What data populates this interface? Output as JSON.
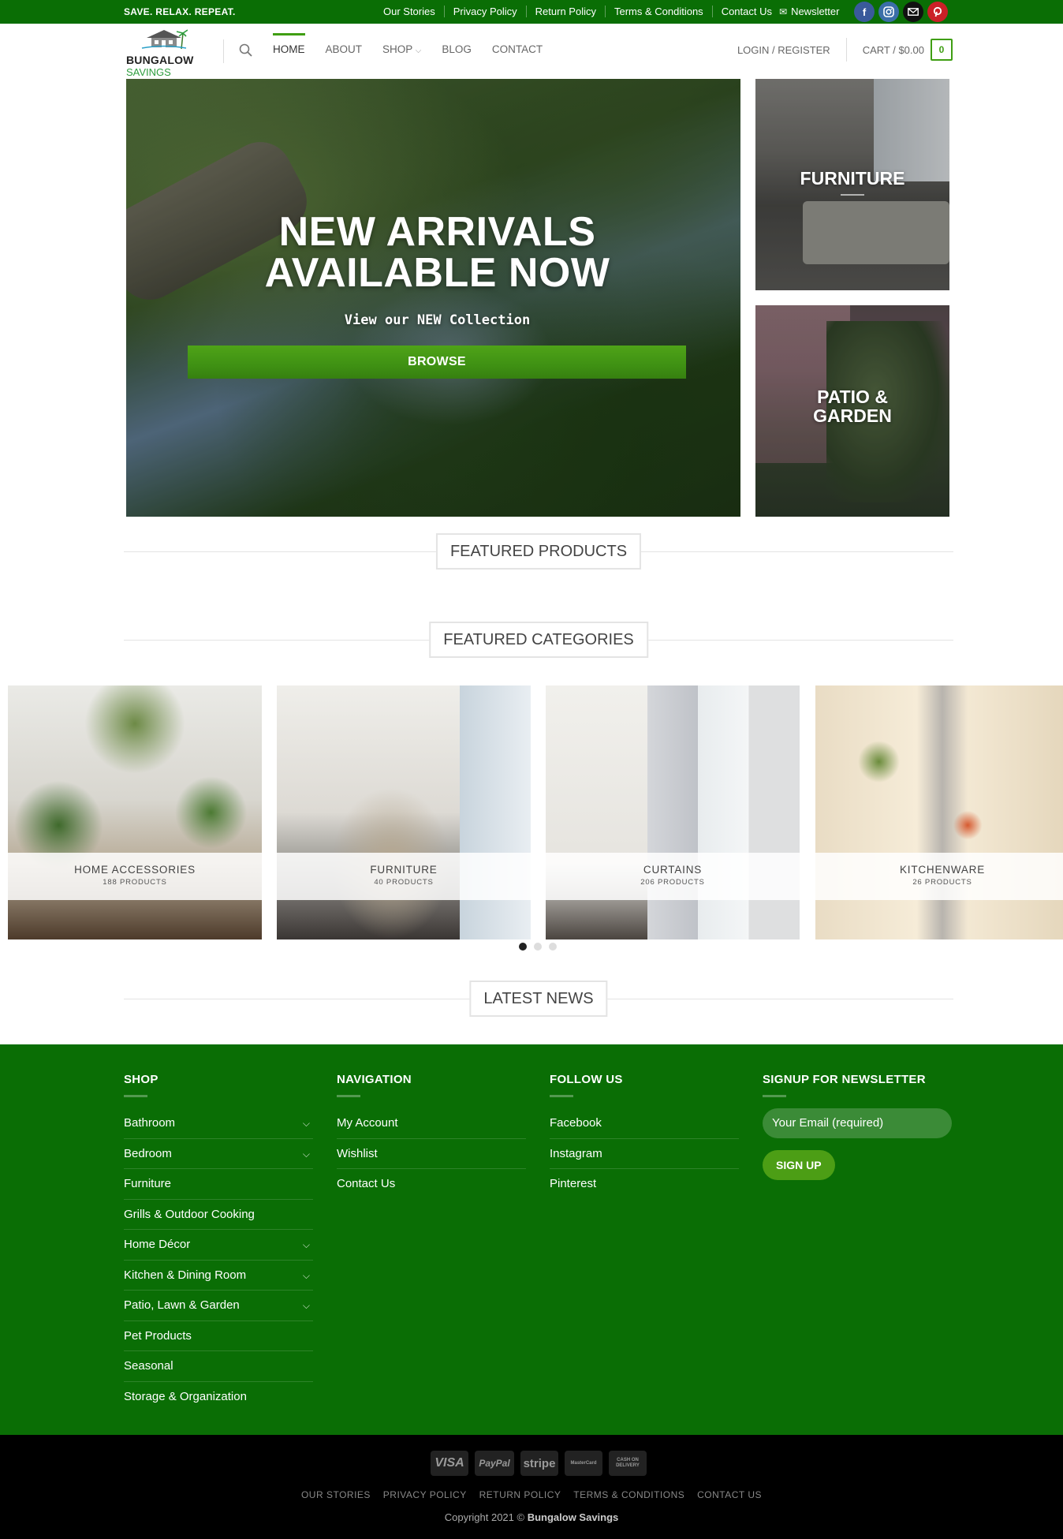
{
  "topbar": {
    "tagline": "SAVE. RELAX. REPEAT.",
    "links": [
      "Our Stories",
      "Privacy Policy",
      "Return Policy",
      "Terms & Conditions",
      "Contact Us"
    ],
    "newsletter": "Newsletter",
    "socials": [
      {
        "name": "facebook-icon",
        "glyph": "f",
        "color": "#3a5a9b"
      },
      {
        "name": "instagram-icon",
        "glyph": "◎",
        "color": "#3b6ea8"
      },
      {
        "name": "email-icon",
        "glyph": "✉",
        "color": "#111111"
      },
      {
        "name": "pinterest-icon",
        "glyph": "℗",
        "color": "#cb2027"
      }
    ]
  },
  "logo": {
    "line1": "BUNGALOW",
    "line2": "SAVINGS"
  },
  "nav": {
    "items": [
      "HOME",
      "ABOUT",
      "SHOP",
      "BLOG",
      "CONTACT"
    ],
    "active": "HOME",
    "shop_chevron": "⌵"
  },
  "header": {
    "login": "LOGIN / REGISTER",
    "cart": "CART / $0.00",
    "cart_count": "0"
  },
  "hero": {
    "title_line1": "NEW ARRIVALS",
    "title_line2": "AVAILABLE NOW",
    "subtitle": "View our NEW Collection",
    "button": "BROWSE"
  },
  "banners": {
    "furniture": "FURNITURE",
    "patio_line1": "PATIO &",
    "patio_line2": "GARDEN"
  },
  "sections": {
    "featured_products": "FEATURED PRODUCTS",
    "featured_categories": "FEATURED CATEGORIES",
    "latest_news": "LATEST NEWS"
  },
  "categories": [
    {
      "name": "HOME ACCESSORIES",
      "count": "188 PRODUCTS"
    },
    {
      "name": "FURNITURE",
      "count": "40 PRODUCTS"
    },
    {
      "name": "CURTAINS",
      "count": "206 PRODUCTS"
    },
    {
      "name": "KITCHENWARE",
      "count": "26 PRODUCTS"
    }
  ],
  "carousel": {
    "pages": 3,
    "current": 1
  },
  "footer": {
    "shop_title": "SHOP",
    "shop_items": [
      {
        "label": "Bathroom",
        "expand": true
      },
      {
        "label": "Bedroom",
        "expand": true
      },
      {
        "label": "Furniture",
        "expand": false
      },
      {
        "label": "Grills & Outdoor Cooking",
        "expand": false
      },
      {
        "label": "Home Décor",
        "expand": true
      },
      {
        "label": "Kitchen & Dining Room",
        "expand": true
      },
      {
        "label": "Patio, Lawn & Garden",
        "expand": true
      },
      {
        "label": "Pet Products",
        "expand": false
      },
      {
        "label": "Seasonal",
        "expand": false
      },
      {
        "label": "Storage & Organization",
        "expand": false
      }
    ],
    "nav_title": "NAVIGATION",
    "nav_items": [
      "My Account",
      "Wishlist",
      "Contact Us"
    ],
    "follow_title": "FOLLOW US",
    "follow_items": [
      "Facebook",
      "Instagram",
      "Pinterest"
    ],
    "newsletter_title": "SIGNUP FOR NEWSLETTER",
    "email_placeholder": "Your Email (required)",
    "signup_button": "SIGN UP"
  },
  "bottom": {
    "payments": [
      "VISA",
      "PayPal",
      "stripe",
      "MasterCard",
      "CASH ON DELIVERY"
    ],
    "links": [
      "OUR STORIES",
      "PRIVACY POLICY",
      "RETURN POLICY",
      "TERMS & CONDITIONS",
      "CONTACT US"
    ],
    "copyright_prefix": "Copyright 2021 ©",
    "copyright_brand": "Bungalow Savings"
  },
  "colors": {
    "brand_green": "#0a6e05",
    "accent_green": "#3f9e13"
  }
}
